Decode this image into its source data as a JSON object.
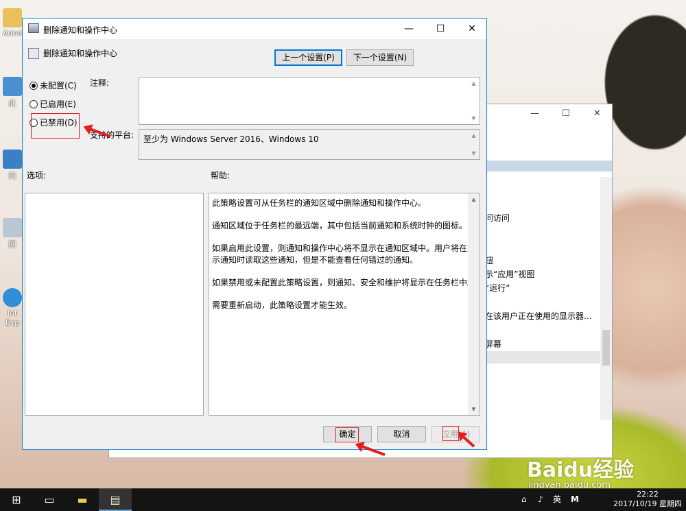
{
  "desktop": {
    "icons": [
      {
        "label": "Admi"
      },
      {
        "label": "此"
      },
      {
        "label": "网"
      },
      {
        "label": "回"
      },
      {
        "label": "Int Exp"
      }
    ]
  },
  "bg_window": {
    "items": [
      "问访问",
      "钮",
      "示“应用”视图",
      "“运行”",
      "在该用户正在使用的显示器...",
      "屏幕"
    ]
  },
  "dialog": {
    "title": "删除通知和操作中心",
    "subtitle": "删除通知和操作中心",
    "prev_setting": "上一个设置(P)",
    "next_setting": "下一个设置(N)",
    "radios": {
      "not_configured": "未配置(C)",
      "enabled": "已启用(E)",
      "disabled": "已禁用(D)",
      "selected": "not_configured"
    },
    "comment_label": "注释:",
    "comment_value": "",
    "supported_label": "支持的平台:",
    "supported_value": "至少为 Windows Server 2016、Windows 10",
    "options_label": "选项:",
    "help_label": "帮助:",
    "help_lines": [
      "此策略设置可从任务栏的通知区域中删除通知和操作中心。",
      "通知区域位于任务栏的最远端，其中包括当前通知和系统时钟的图标。",
      "如果启用此设置，则通知和操作中心将不显示在通知区域中。用户将在显",
      "示通知时读取这些通知，但是不能查看任何错过的通知。",
      "如果禁用或未配置此策略设置，则通知、安全和维护将显示在任务栏中。",
      "需要重新启动，此策略设置才能生效。"
    ],
    "ok": "确定",
    "cancel": "取消",
    "apply": "应用(A)"
  },
  "taskbar": {
    "ime": "英",
    "ime2": "M",
    "time": "22:22",
    "date": "2017/10/19 星期四"
  },
  "watermark": {
    "brand": "Baidu经验",
    "url": "jingyan.baidu.com"
  },
  "colors": {
    "accent": "#0078d7",
    "annotation": "#e02020",
    "dialog_bg": "#f0f0f0",
    "taskbar": "#141414"
  }
}
